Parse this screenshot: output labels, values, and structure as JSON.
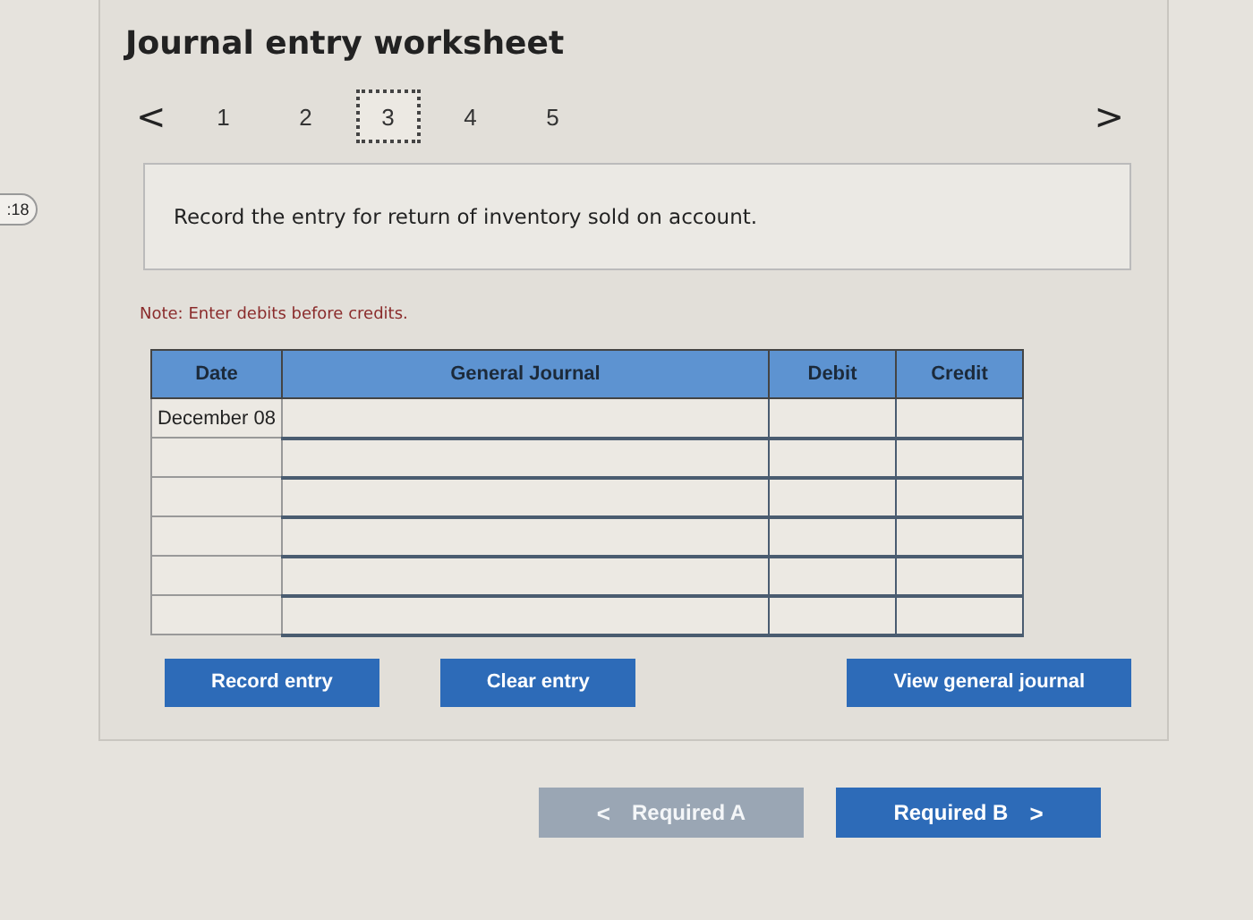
{
  "side_badge": ":18",
  "worksheet": {
    "title": "Journal entry worksheet",
    "prev": "<",
    "next": ">",
    "pages": [
      {
        "label": "1",
        "selected": false
      },
      {
        "label": "2",
        "selected": false
      },
      {
        "label": "3",
        "selected": true
      },
      {
        "label": "4",
        "selected": false
      },
      {
        "label": "5",
        "selected": false
      }
    ],
    "instruction": "Record the entry for return of inventory sold on account.",
    "note": "Note: Enter debits before credits.",
    "table": {
      "columns": [
        "Date",
        "General Journal",
        "Debit",
        "Credit"
      ],
      "rows": [
        {
          "date": "December 08"
        },
        {
          "date": ""
        },
        {
          "date": ""
        },
        {
          "date": ""
        },
        {
          "date": ""
        },
        {
          "date": ""
        }
      ]
    },
    "buttons": [
      {
        "label": "Record entry"
      },
      {
        "label": "Clear entry"
      },
      {
        "label": "View general journal"
      }
    ]
  },
  "nav": [
    {
      "label": "Required A",
      "arrow": "<",
      "disabled": true
    },
    {
      "label": "Required B",
      "arrow": ">",
      "disabled": false
    }
  ]
}
